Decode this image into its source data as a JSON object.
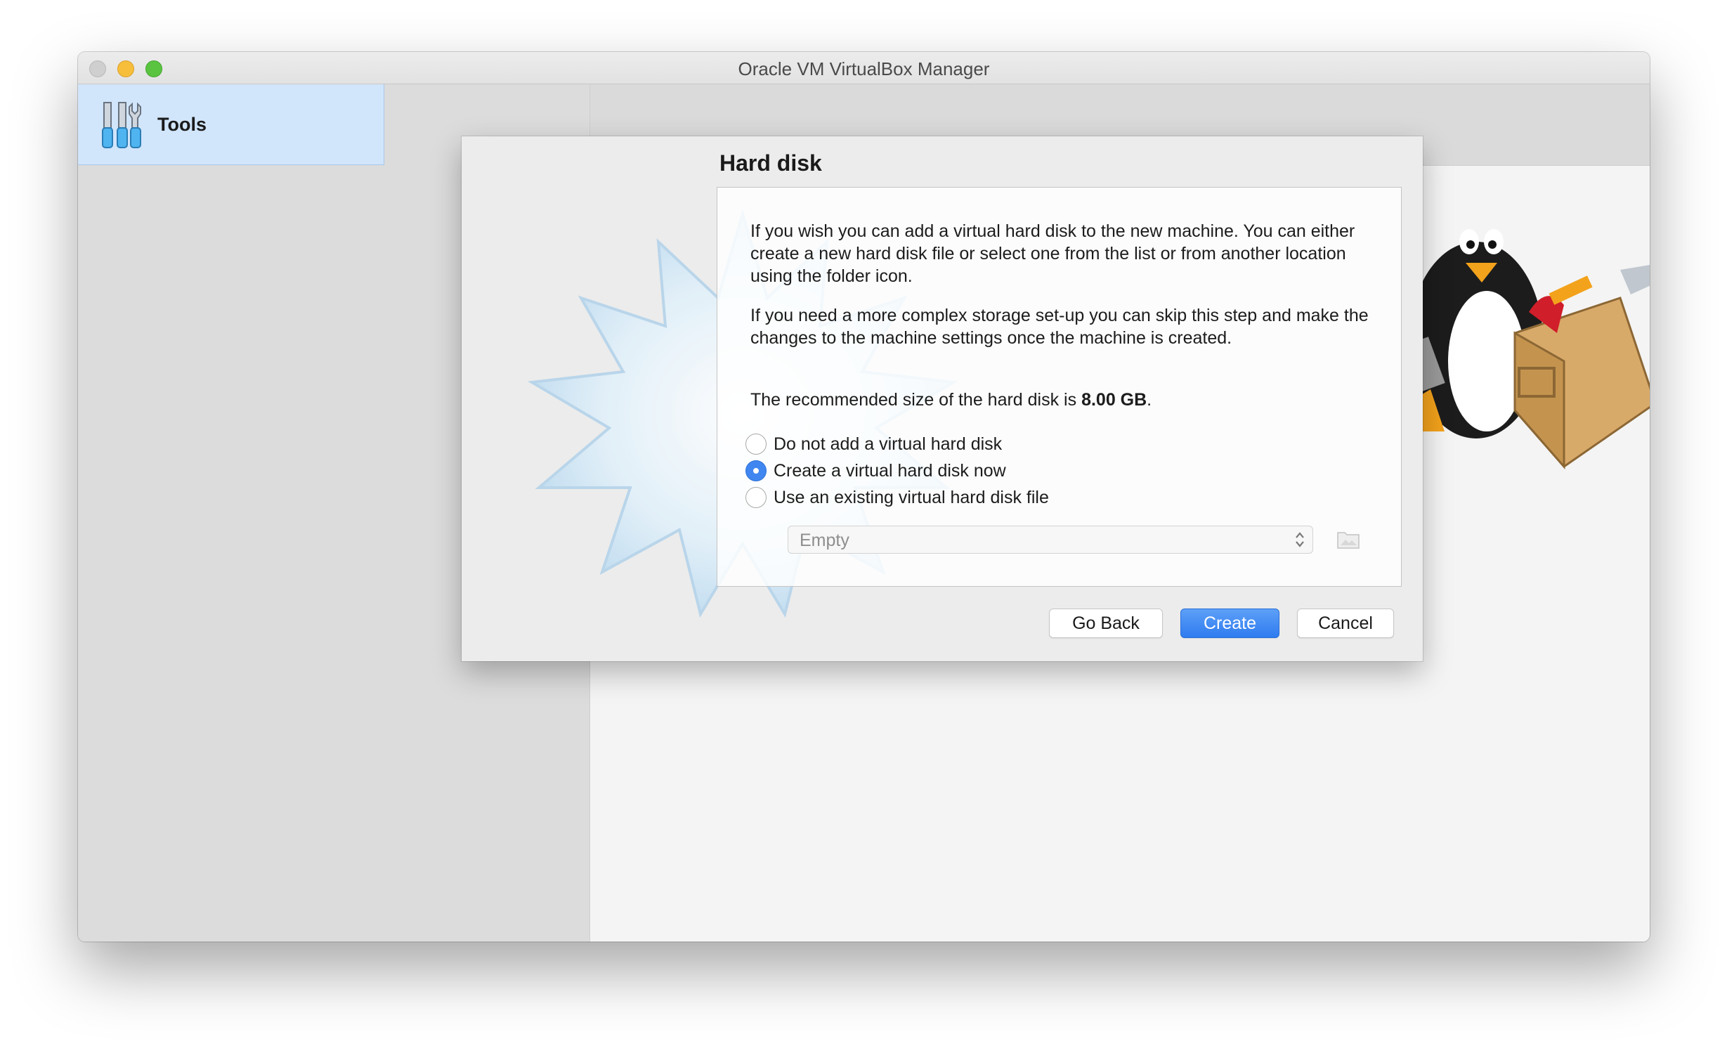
{
  "window": {
    "title": "Oracle VM VirtualBox Manager"
  },
  "sidebar": {
    "tools_label": "Tools",
    "tools_icon": "tools-icon"
  },
  "dialog": {
    "title": "Hard disk",
    "paragraph1": "If you wish you can add a virtual hard disk to the new machine. You can either create a new hard disk file or select one from the list or from another location using the folder icon.",
    "paragraph2": "If you need a more complex storage set-up you can skip this step and make the changes to the machine settings once the machine is created.",
    "recommended_prefix": "The recommended size of the hard disk is ",
    "recommended_size": "8.00 GB",
    "recommended_suffix": ".",
    "options": [
      {
        "label": "Do not add a virtual hard disk",
        "checked": false
      },
      {
        "label": "Create a virtual hard disk now",
        "checked": true
      },
      {
        "label": "Use an existing virtual hard disk file",
        "checked": false
      }
    ],
    "disk_select": {
      "value": "Empty"
    },
    "folder_icon": "folder-icon",
    "buttons": {
      "back": "Go Back",
      "create": "Create",
      "cancel": "Cancel"
    }
  },
  "colors": {
    "accent": "#2f7bf0",
    "sidebar_selected": "#d1e5fb",
    "close": "#cfcfcf",
    "minimize": "#f6be3b",
    "maximize": "#5ac440"
  }
}
